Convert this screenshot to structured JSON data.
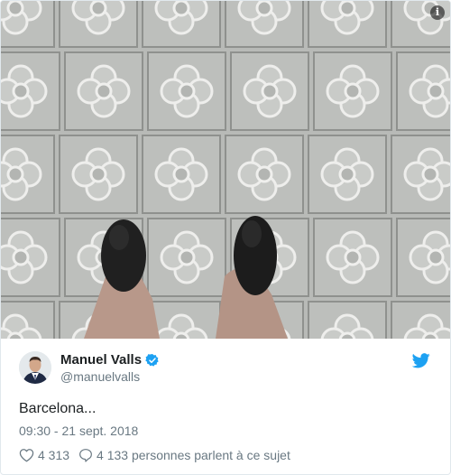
{
  "tweet": {
    "author_name": "Manuel Valls",
    "author_handle": "@manuelvalls",
    "text": "Barcelona...",
    "timestamp": "09:30 - 21 sept. 2018",
    "likes": "4 313",
    "replies_text": "4 133 personnes parlent à ce sujet"
  },
  "icons": {
    "info": "i",
    "verified": "verified-badge-icon",
    "brand": "twitter-bird-icon",
    "like": "heart-icon",
    "reply": "speech-bubble-icon"
  },
  "colors": {
    "brand_blue": "#1da1f2",
    "text_primary": "#1c2022",
    "text_secondary": "#697882",
    "pavement": "#b8bab7"
  }
}
